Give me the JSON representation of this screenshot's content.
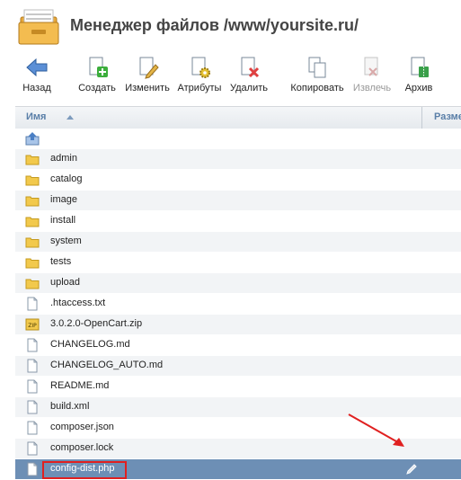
{
  "header": {
    "title": "Менеджер файлов /www/yoursite.ru/"
  },
  "toolbar": {
    "back": "Назад",
    "create": "Создать",
    "edit": "Изменить",
    "attributes": "Атрибуты",
    "delete": "Удалить",
    "copy": "Копировать",
    "extract": "Извлечь",
    "archive": "Архив"
  },
  "table": {
    "col_name": "Имя",
    "col_size": "Разме"
  },
  "rows": [
    {
      "name": "",
      "type": "up"
    },
    {
      "name": "admin",
      "type": "folder"
    },
    {
      "name": "catalog",
      "type": "folder"
    },
    {
      "name": "image",
      "type": "folder"
    },
    {
      "name": "install",
      "type": "folder"
    },
    {
      "name": "system",
      "type": "folder"
    },
    {
      "name": "tests",
      "type": "folder"
    },
    {
      "name": "upload",
      "type": "folder"
    },
    {
      "name": ".htaccess.txt",
      "type": "file"
    },
    {
      "name": "3.0.2.0-OpenCart.zip",
      "type": "zip"
    },
    {
      "name": "CHANGELOG.md",
      "type": "file"
    },
    {
      "name": "CHANGELOG_AUTO.md",
      "type": "file"
    },
    {
      "name": "README.md",
      "type": "file"
    },
    {
      "name": "build.xml",
      "type": "file"
    },
    {
      "name": "composer.json",
      "type": "file"
    },
    {
      "name": "composer.lock",
      "type": "file"
    },
    {
      "name": "config-dist.php",
      "type": "file",
      "selected": true
    }
  ],
  "colors": {
    "selected_row": "#6d8fb5",
    "annotation": "#e02020",
    "folder": "#f2c94c"
  }
}
